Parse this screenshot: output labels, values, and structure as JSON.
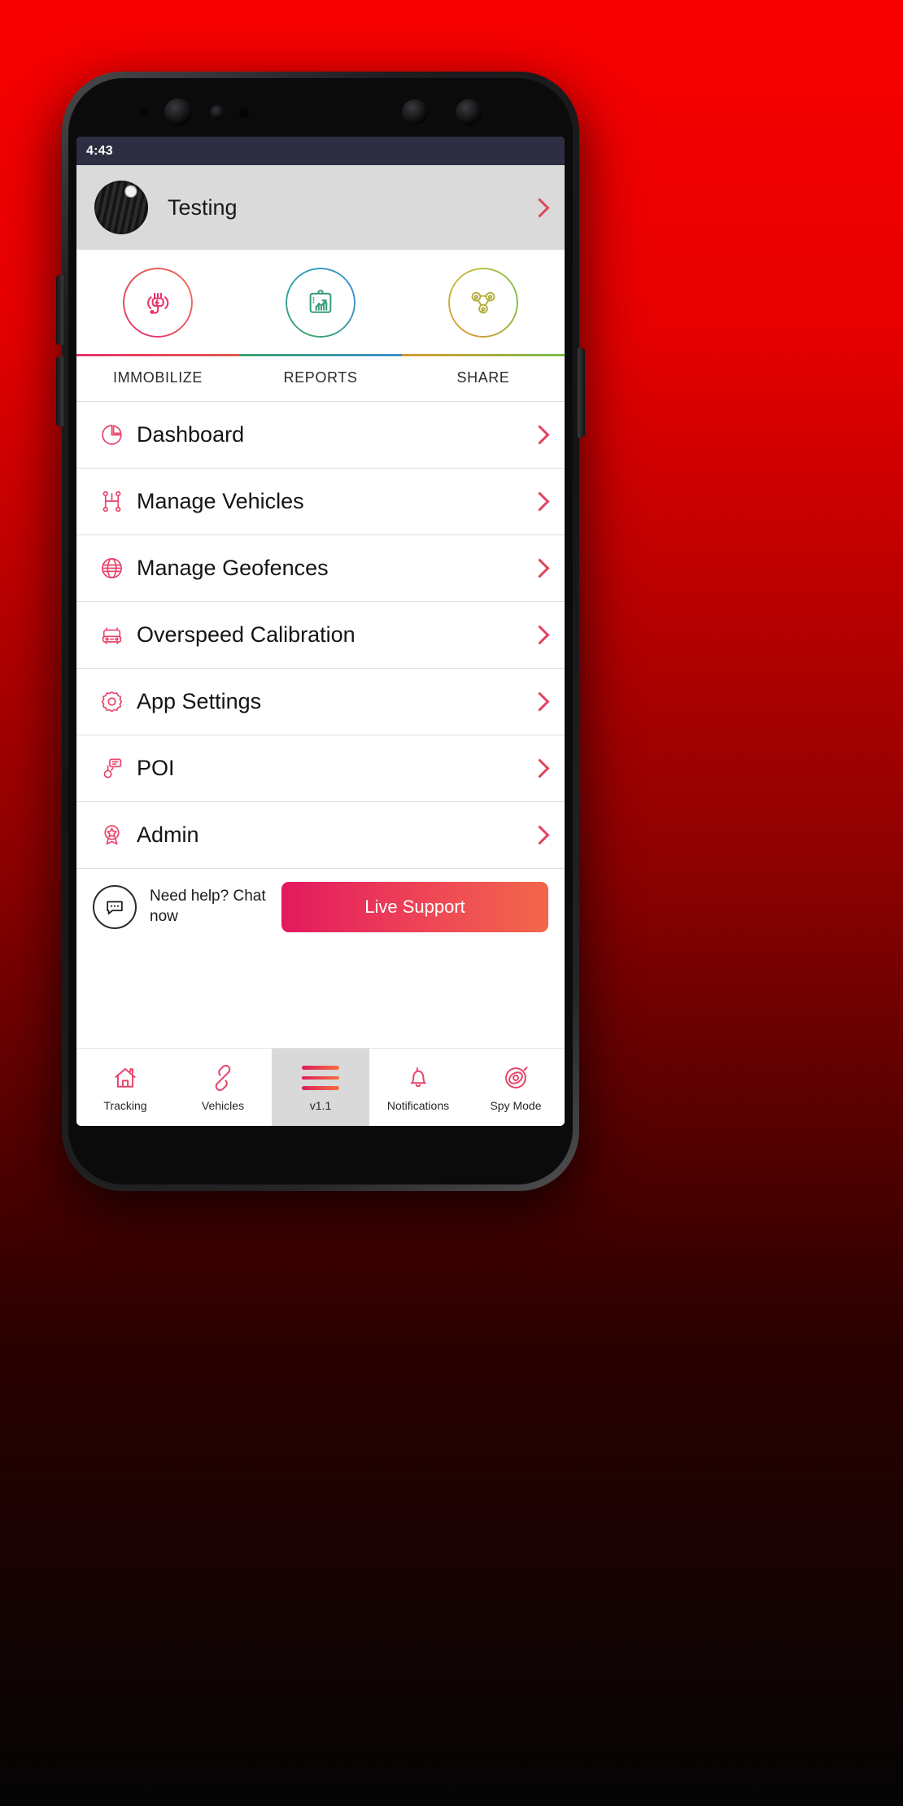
{
  "status_bar": {
    "time": "4:43"
  },
  "profile": {
    "name": "Testing",
    "avatar_icon": "avatar-photo",
    "chevron_icon": "chevron-right-icon"
  },
  "quick_actions": [
    {
      "label": "IMMOBILIZE",
      "icon": "plug-immobilize-icon",
      "accent": "#e8336a"
    },
    {
      "label": "REPORTS",
      "icon": "report-chart-clipboard-icon",
      "accent": "#3aa76d"
    },
    {
      "label": "SHARE",
      "icon": "share-users-network-icon",
      "accent": "#b4b03c"
    }
  ],
  "menu": [
    {
      "label": "Dashboard",
      "icon": "pie-chart-icon"
    },
    {
      "label": "Manage Vehicles",
      "icon": "gear-shift-icon"
    },
    {
      "label": "Manage Geofences",
      "icon": "globe-icon"
    },
    {
      "label": "Overspeed Calibration",
      "icon": "car-icon"
    },
    {
      "label": "App Settings",
      "icon": "gear-icon"
    },
    {
      "label": "POI",
      "icon": "map-pin-message-icon"
    },
    {
      "label": "Admin",
      "icon": "badge-star-icon"
    }
  ],
  "support": {
    "icon": "chat-bubble-icon",
    "text": "Need help? Chat now",
    "button_label": "Live Support"
  },
  "bottom_tabs": [
    {
      "label": "Tracking",
      "icon": "home-icon",
      "active": false
    },
    {
      "label": "Vehicles",
      "icon": "link-chain-icon",
      "active": false
    },
    {
      "label": "v1.1",
      "icon": "hamburger-menu-icon",
      "active": true
    },
    {
      "label": "Notifications",
      "icon": "bell-icon",
      "active": false
    },
    {
      "label": "Spy Mode",
      "icon": "eye-target-icon",
      "active": false
    }
  ],
  "colors": {
    "accent_pink": "#e3195f",
    "accent_orange": "#f2674b",
    "status_bar": "#2e2e42",
    "header_bg": "#dadada",
    "background_red": "#f80000"
  }
}
